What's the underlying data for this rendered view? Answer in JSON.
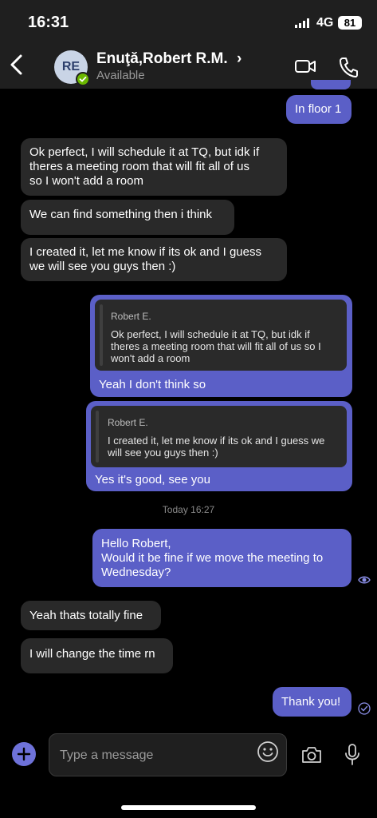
{
  "status": {
    "time": "16:31",
    "network": "4G",
    "battery": "81"
  },
  "header": {
    "avatar_initials": "RE",
    "contact_name": "Enuţă,Robert R.M.",
    "chevron": "›",
    "presence": "Available"
  },
  "messages": [
    {
      "from": "me",
      "text": "In floor 1"
    },
    {
      "from": "them",
      "lines": [
        "Ok perfect, I will schedule it at TQ, but idk if",
        "theres a meeting room that will fit all of us",
        "so I won't add a room"
      ]
    },
    {
      "from": "them",
      "text": "We can find something then i think"
    },
    {
      "from": "them",
      "lines": [
        "I created it, let me know if its ok and I guess",
        "we will see you guys then :)"
      ]
    },
    {
      "from": "me",
      "quote": {
        "author": "Robert E.",
        "lines": [
          "Ok perfect, I will schedule it at TQ, but idk if",
          "theres a meeting room that will fit all of us so I",
          "won't add a room"
        ]
      },
      "text": "Yeah I don't think so"
    },
    {
      "from": "me",
      "quote": {
        "author": "Robert E.",
        "lines": [
          "I created it, let me know if its ok and I guess we",
          "will see you guys then :)"
        ]
      },
      "text": "Yes it's good, see you"
    },
    {
      "from": "me",
      "lines": [
        "Hello Robert,",
        "Would it be fine if we move the meeting to",
        "Wednesday?"
      ]
    },
    {
      "from": "them",
      "text": "Yeah thats totally fine"
    },
    {
      "from": "them",
      "text": "I will change the time rn"
    },
    {
      "from": "me",
      "text": "Thank you!"
    }
  ],
  "timestamp": "Today 16:27",
  "compose": {
    "placeholder": "Type a message"
  },
  "colors": {
    "outgoing": "#5b5fc7",
    "incoming": "#292929",
    "presence": "#6bb700",
    "background": "#000000"
  },
  "icons": [
    "back-icon",
    "video-call-icon",
    "phone-call-icon",
    "seen-icon",
    "delivered-check-icon",
    "add-icon",
    "emoji-icon",
    "camera-icon",
    "microphone-icon"
  ]
}
